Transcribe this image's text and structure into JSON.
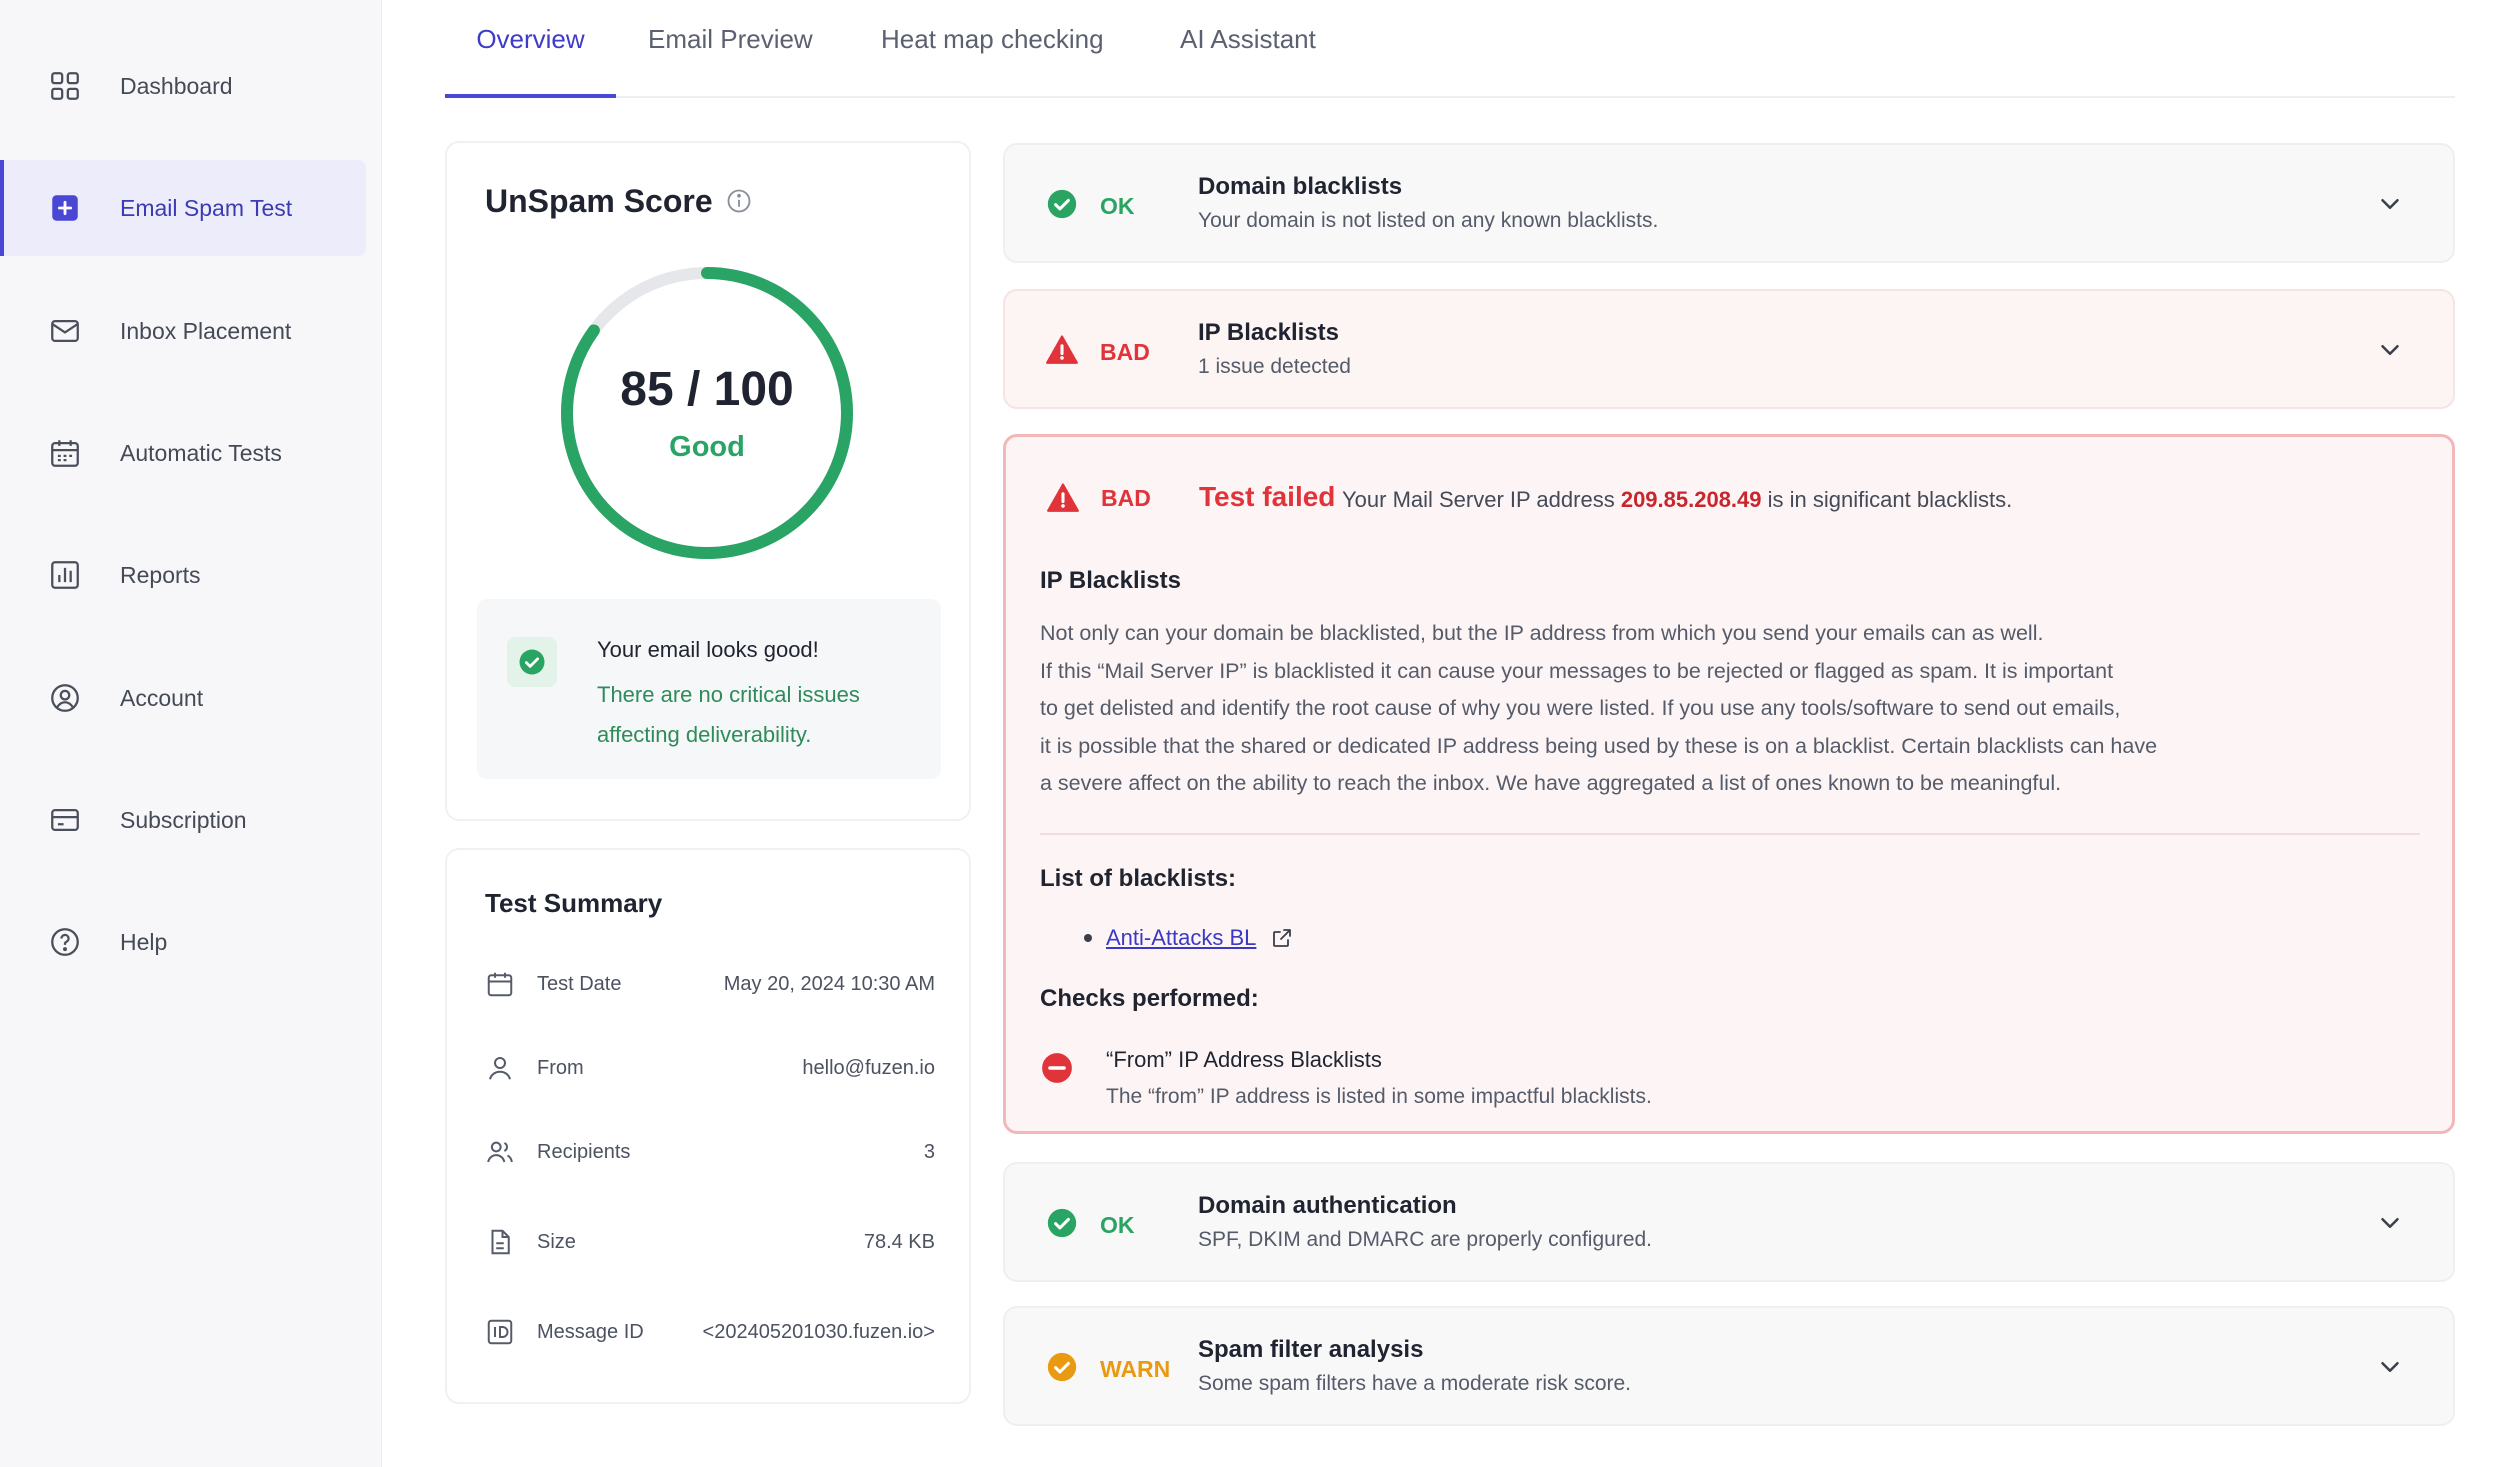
{
  "sidebar": {
    "items": [
      {
        "label": "Dashboard",
        "icon": "dashboard-icon"
      },
      {
        "label": "Email Spam Test",
        "icon": "plus-square-icon",
        "active": true
      },
      {
        "label": "Inbox Placement",
        "icon": "mail-icon"
      },
      {
        "label": "Automatic Tests",
        "icon": "calendar-icon"
      },
      {
        "label": "Reports",
        "icon": "bar-chart-icon"
      },
      {
        "label": "Account",
        "icon": "user-circle-icon"
      },
      {
        "label": "Subscription",
        "icon": "credit-card-icon"
      },
      {
        "label": "Help",
        "icon": "help-circle-icon"
      }
    ]
  },
  "tabs": [
    {
      "label": "Overview",
      "active": true
    },
    {
      "label": "Email Preview"
    },
    {
      "label": "Heat map checking"
    },
    {
      "label": "AI Assistant"
    }
  ],
  "score": {
    "title": "UnSpam Score",
    "value_text": "85 / 100",
    "value": 85,
    "max": 100,
    "rating": "Good",
    "good_title": "Your email looks good!",
    "good_desc": "There are no critical issues affecting deliverability."
  },
  "summary": {
    "title": "Test Summary",
    "rows": [
      {
        "label": "Test Date",
        "value": "May 20, 2024 10:30 AM",
        "icon": "calendar-icon"
      },
      {
        "label": "From",
        "value": "hello@fuzen.io",
        "icon": "user-icon"
      },
      {
        "label": "Recipients",
        "value": "3",
        "icon": "users-icon"
      },
      {
        "label": "Size",
        "value": "78.4 KB",
        "icon": "file-icon"
      },
      {
        "label": "Message ID",
        "value": "<202405201030.fuzen.io>",
        "icon": "id-icon"
      }
    ]
  },
  "checks": [
    {
      "status": "OK",
      "title": "Domain blacklists",
      "desc": "Your domain is not listed on any known blacklists."
    },
    {
      "status": "BAD",
      "title": "IP Blacklists",
      "desc": "1 issue detected"
    },
    {
      "status": "OK",
      "title": "Domain authentication",
      "desc": "SPF, DKIM and DMARC are properly configured."
    },
    {
      "status": "WARN",
      "title": "Spam filter analysis",
      "desc": "Some spam filters have a moderate risk score."
    }
  ],
  "detail": {
    "status": "BAD",
    "failed_title": "Test failed",
    "msg_prefix": "Your Mail Server IP address",
    "ip": "209.85.208.49",
    "msg_suffix": "is in significant blacklists.",
    "heading": "IP Blacklists",
    "paragraph_lines": [
      "Not only can your domain be blacklisted, but the IP address from which you send your emails can as well.",
      "If this “Mail Server IP” is blacklisted it can cause your messages to be rejected or flagged as spam. It is important",
      "to get delisted and identify the root cause of why you were listed. If you use any tools/software to send out emails,",
      "it is possible that the shared or dedicated IP address being used by these is on a blacklist. Certain blacklists can have",
      "a severe affect on the ability to reach the inbox. We have aggregated a list of ones known to be meaningful."
    ],
    "list_heading": "List of blacklists:",
    "blacklists": [
      "Anti-Attacks BL"
    ],
    "checks_heading": "Checks performed:",
    "check_title": "“From” IP Address Blacklists",
    "check_desc": "The “from” IP address is listed in some impactful blacklists."
  },
  "colors": {
    "accent": "#4a47d4",
    "ok": "#2aa462",
    "bad": "#e0333a",
    "warn": "#ea9a10"
  }
}
